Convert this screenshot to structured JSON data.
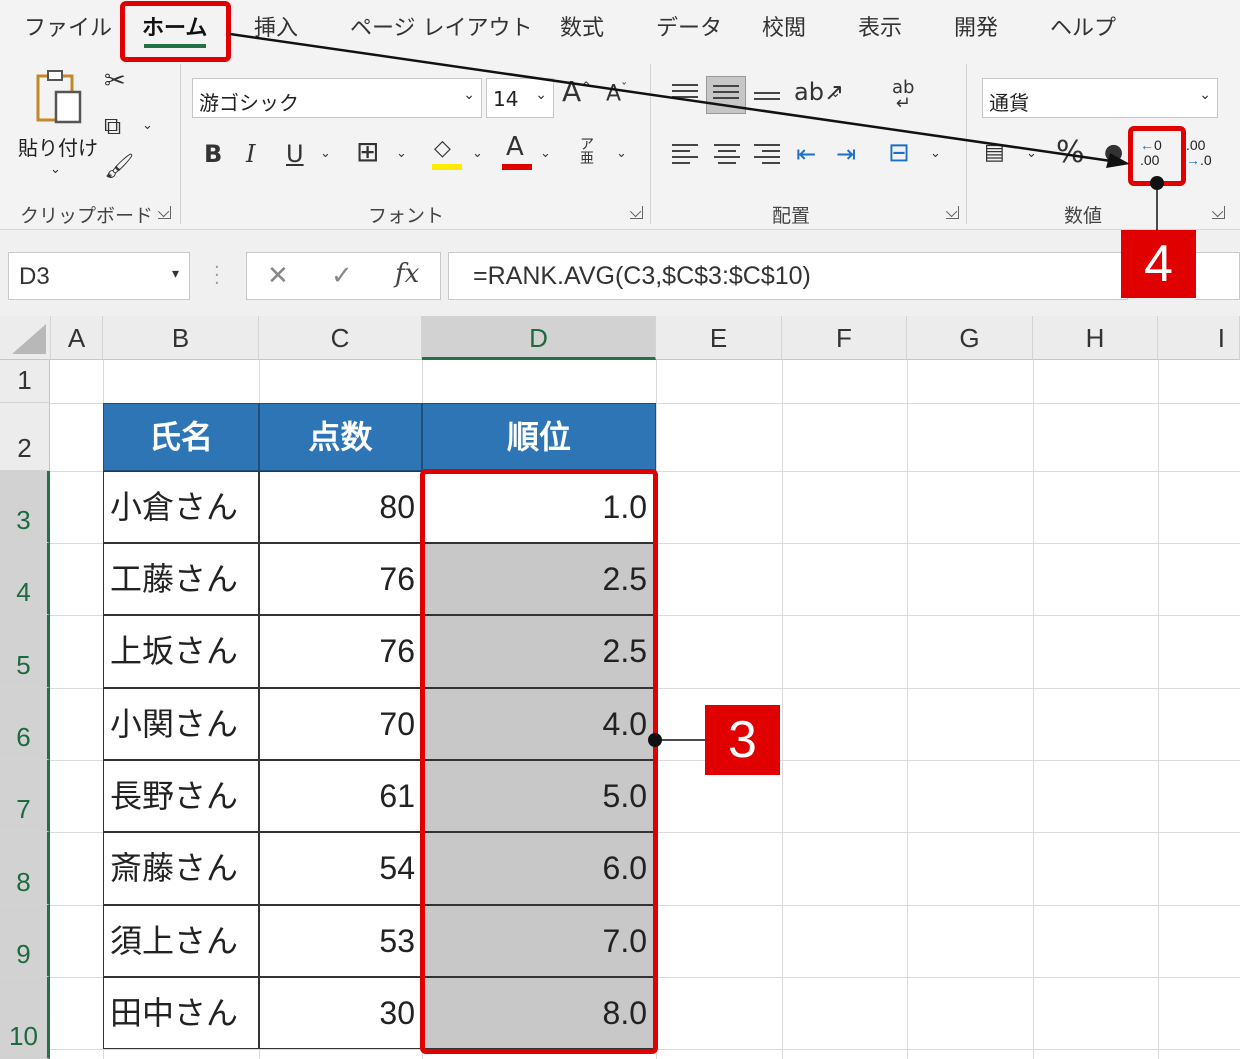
{
  "tabs": [
    "ファイル",
    "ホーム",
    "挿入",
    "ページ レイアウト",
    "数式",
    "データ",
    "校閲",
    "表示",
    "開発",
    "ヘルプ"
  ],
  "active_tab": "ホーム",
  "ribbon": {
    "clipboard": {
      "paste_label": "貼り付け",
      "group_label": "クリップボード"
    },
    "font": {
      "font_name": "游ゴシック",
      "font_size": "14",
      "bold": "B",
      "italic": "I",
      "underline": "U",
      "group_label": "フォント"
    },
    "alignment": {
      "group_label": "配置"
    },
    "number": {
      "format": "通貨",
      "percent": "%",
      "group_label": "数値"
    }
  },
  "name_box": "D3",
  "formula": "=RANK.AVG(C3,$C$3:$C$10)",
  "columns": [
    "A",
    "B",
    "C",
    "D",
    "E",
    "F",
    "G",
    "H",
    "I"
  ],
  "rows": [
    "1",
    "2",
    "3",
    "4",
    "5",
    "6",
    "7",
    "8",
    "9",
    "10"
  ],
  "table": {
    "headers": [
      "氏名",
      "点数",
      "順位"
    ],
    "rows": [
      {
        "name": "小倉さん",
        "score": "80",
        "rank": "1.0"
      },
      {
        "name": "工藤さん",
        "score": "76",
        "rank": "2.5"
      },
      {
        "name": "上坂さん",
        "score": "76",
        "rank": "2.5"
      },
      {
        "name": "小関さん",
        "score": "70",
        "rank": "4.0"
      },
      {
        "name": "長野さん",
        "score": "61",
        "rank": "5.0"
      },
      {
        "name": "斎藤さん",
        "score": "54",
        "rank": "6.0"
      },
      {
        "name": "須上さん",
        "score": "53",
        "rank": "7.0"
      },
      {
        "name": "田中さん",
        "score": "30",
        "rank": "8.0"
      }
    ]
  },
  "callouts": {
    "step3": "3",
    "step4": "4"
  },
  "colors": {
    "accent_green": "#217346",
    "header_blue": "#2e75b6",
    "callout_red": "#e00000"
  }
}
